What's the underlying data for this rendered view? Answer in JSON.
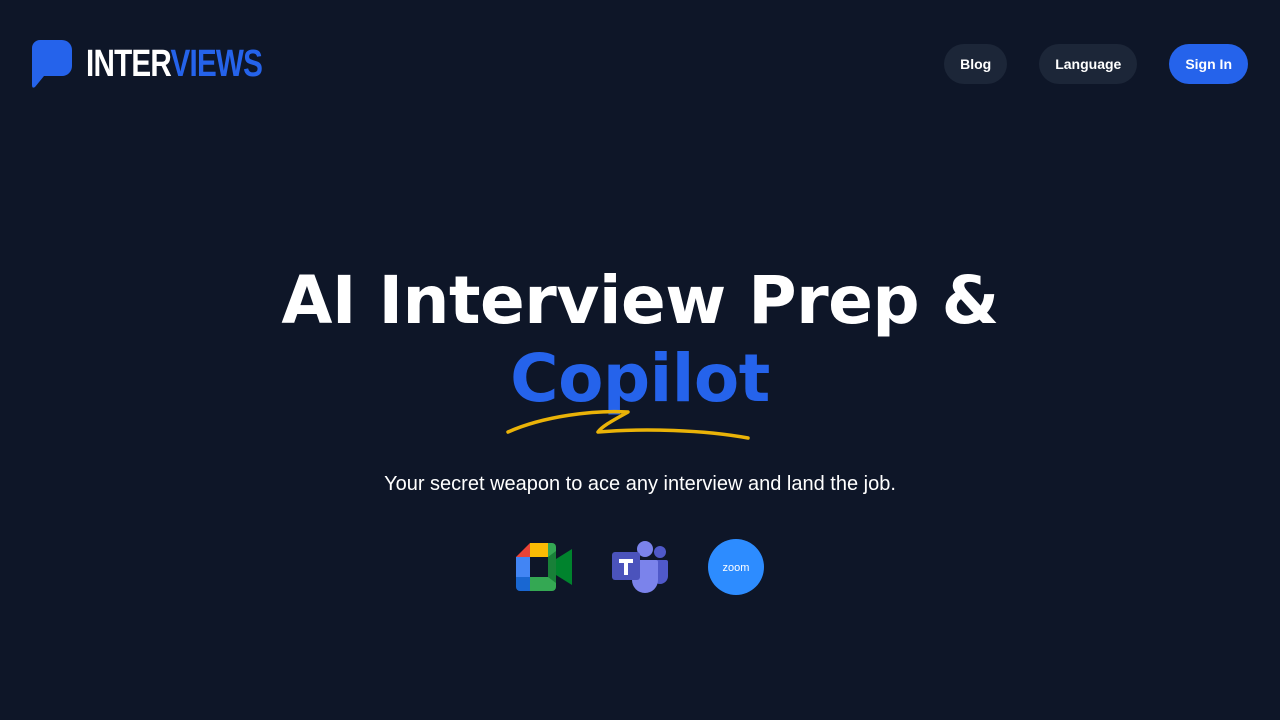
{
  "brand": {
    "name_part1": "INTER",
    "name_part2": "VIEWS",
    "logo_icon": "speech-bubble-icon",
    "accent_color": "#2563eb",
    "background_color": "#0e1628"
  },
  "nav": {
    "blog_label": "Blog",
    "language_label": "Language",
    "sign_in_label": "Sign In"
  },
  "hero": {
    "title_line1": "AI Interview Prep &",
    "title_accent": "Copilot",
    "subtitle": "Your secret weapon to ace any interview and land the job.",
    "underline_color": "#eab308"
  },
  "platforms": [
    {
      "icon": "google-meet-icon"
    },
    {
      "icon": "microsoft-teams-icon"
    },
    {
      "icon": "zoom-icon",
      "label": "zoom"
    }
  ]
}
